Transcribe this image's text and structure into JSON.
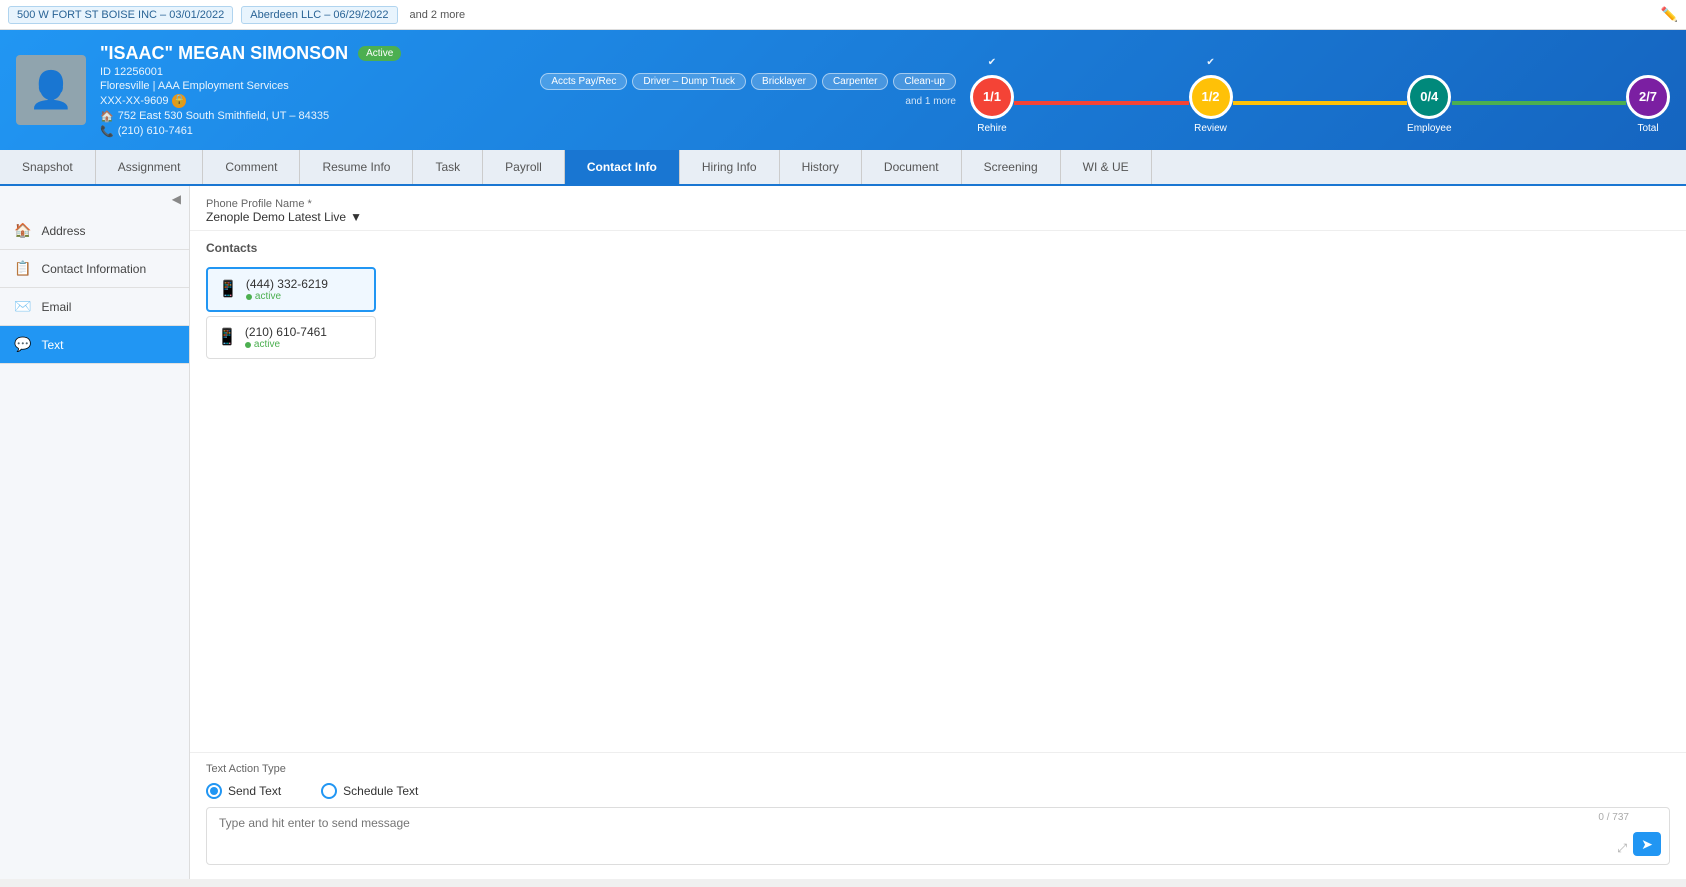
{
  "topbar": {
    "tag1": "500 W FORT ST BOISE INC – 03/01/2022",
    "tag2": "Aberdeen LLC – 06/29/2022",
    "more": "and 2 more"
  },
  "profile": {
    "name": "\"ISAAC\" MEGAN SIMONSON",
    "status": "Active",
    "id_label": "ID 12256001",
    "company": "Floresville | AAA Employment Services",
    "ssn": "XXX-XX-9609",
    "address": "752 East 530 South Smithfield, UT – 84335",
    "phone": "(210) 610-7461"
  },
  "skills": {
    "tags": [
      "Accts Pay/Rec",
      "Driver – Dump Truck",
      "Bricklayer",
      "Carpenter",
      "Clean-up"
    ],
    "more": "and 1 more"
  },
  "progress": {
    "nodes": [
      {
        "label": "Rehire",
        "value": "1/1",
        "color": "red",
        "check": true
      },
      {
        "label": "Review",
        "value": "1/2",
        "color": "yellow",
        "check": true
      },
      {
        "label": "Employee",
        "value": "0/4",
        "color": "teal",
        "check": false
      }
    ],
    "total": {
      "label": "Total",
      "value": "2/7",
      "color": "purple"
    }
  },
  "tabs": [
    {
      "id": "snapshot",
      "label": "Snapshot"
    },
    {
      "id": "assignment",
      "label": "Assignment"
    },
    {
      "id": "comment",
      "label": "Comment"
    },
    {
      "id": "resume-info",
      "label": "Resume Info"
    },
    {
      "id": "task",
      "label": "Task"
    },
    {
      "id": "payroll",
      "label": "Payroll"
    },
    {
      "id": "contact-info",
      "label": "Contact Info"
    },
    {
      "id": "hiring-info",
      "label": "Hiring Info"
    },
    {
      "id": "history",
      "label": "History"
    },
    {
      "id": "document",
      "label": "Document"
    },
    {
      "id": "screening",
      "label": "Screening"
    },
    {
      "id": "wi-ue",
      "label": "WI & UE"
    }
  ],
  "sidebar": {
    "items": [
      {
        "id": "address",
        "label": "Address",
        "icon": "🏠"
      },
      {
        "id": "contact-information",
        "label": "Contact Information",
        "icon": "📋"
      },
      {
        "id": "email",
        "label": "Email",
        "icon": "✉️"
      },
      {
        "id": "text",
        "label": "Text",
        "icon": "💬"
      }
    ]
  },
  "contact_info": {
    "phone_profile_label": "Phone Profile Name *",
    "phone_profile_value": "Zenople Demo Latest Live",
    "contacts_label": "Contacts",
    "contacts": [
      {
        "number": "(444) 332-6219",
        "status": "active",
        "selected": true
      },
      {
        "number": "(210) 610-7461",
        "status": "active",
        "selected": false
      }
    ]
  },
  "text_action": {
    "label": "Text Action Type",
    "options": [
      {
        "id": "send-text",
        "label": "Send Text",
        "checked": true
      },
      {
        "id": "schedule-text",
        "label": "Schedule Text",
        "checked": false
      }
    ],
    "char_count": "0 / 737",
    "placeholder": "Type and hit enter to send message",
    "send_label": "➤"
  }
}
